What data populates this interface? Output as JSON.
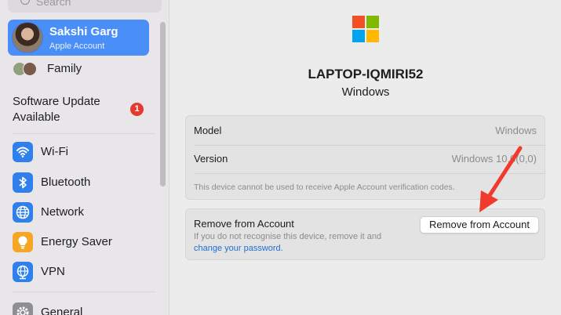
{
  "sidebar": {
    "search_placeholder": "Search",
    "account": {
      "name": "Sakshi Garg",
      "subtitle": "Apple Account"
    },
    "family_label": "Family",
    "update": {
      "label": "Software Update Available",
      "badge": "1"
    },
    "items": [
      {
        "label": "Wi-Fi",
        "icon": "wifi-icon",
        "color": "#2f80ed"
      },
      {
        "label": "Bluetooth",
        "icon": "bluetooth-icon",
        "color": "#2f80ed"
      },
      {
        "label": "Network",
        "icon": "globe-icon",
        "color": "#2f80ed"
      },
      {
        "label": "Energy Saver",
        "icon": "lightbulb-icon",
        "color": "#f5a623"
      },
      {
        "label": "VPN",
        "icon": "vpn-globe-icon",
        "color": "#2f80ed"
      },
      {
        "label": "General",
        "icon": "gear-icon",
        "color": "#8e8e93"
      }
    ]
  },
  "device": {
    "name": "LAPTOP-IQMIRI52",
    "os": "Windows",
    "logo_colors": [
      "#f25022",
      "#7fba00",
      "#00a4ef",
      "#ffb900"
    ]
  },
  "details": {
    "model_label": "Model",
    "model_value": "Windows",
    "version_label": "Version",
    "version_value": "Windows 10.0(0,0)",
    "note": "This device cannot be used to receive Apple Account verification codes."
  },
  "remove": {
    "title": "Remove from Account",
    "description": "If you do not recognise this device, remove it and",
    "link": "change your password.",
    "button": "Remove from Account"
  },
  "annotation": {
    "arrow_color": "#f03a2e"
  }
}
